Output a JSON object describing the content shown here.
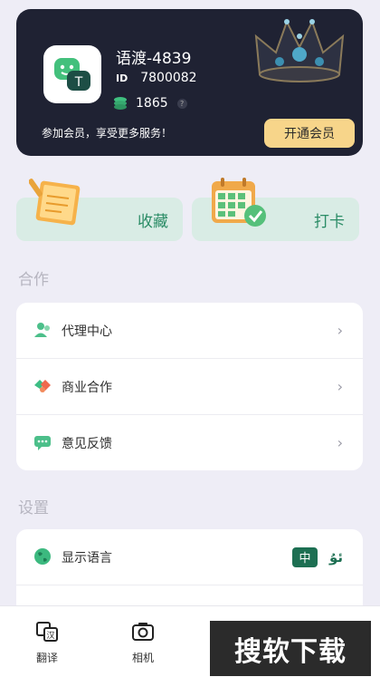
{
  "profile": {
    "username": "语渡-4839",
    "id_tag": "ID",
    "id_value": "7800082",
    "coins": "1865",
    "help": "?",
    "promo": "参加会员，享受更多服务！",
    "vip_button": "开通会员"
  },
  "tiles": {
    "favorites": "收藏",
    "checkin": "打卡"
  },
  "sections": {
    "cooperation": "合作",
    "settings": "设置"
  },
  "cooperation_items": [
    {
      "label": "代理中心"
    },
    {
      "label": "商业合作"
    },
    {
      "label": "意见反馈"
    }
  ],
  "settings_items": [
    {
      "label": "显示语言",
      "lang_zh": "中",
      "lang_ug": "ئۇ"
    }
  ],
  "nav": {
    "translate": "翻译",
    "camera": "相机"
  },
  "watermark": "搜软下载",
  "colors": {
    "accent": "#2b8c66",
    "header_bg": "#1f2233",
    "vip": "#f7d58a"
  }
}
